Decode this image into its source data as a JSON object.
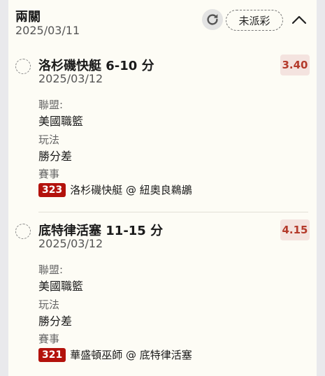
{
  "header": {
    "title": "兩關",
    "date": "2025/03/11",
    "status_label": "未派彩"
  },
  "picks": [
    {
      "title": "洛杉磯快艇 6-10 分",
      "date": "2025/03/12",
      "odds": "3.40",
      "league_label": "聯盟:",
      "league": "美國職籃",
      "market_label": "玩法",
      "market": "勝分差",
      "event_label": "賽事",
      "event_no": "323",
      "event": "洛杉磯快艇 @ 紐奧良鵜鶘"
    },
    {
      "title": "底特律活塞 11-15 分",
      "date": "2025/03/12",
      "odds": "4.15",
      "league_label": "聯盟:",
      "league": "美國職籃",
      "market_label": "玩法",
      "market": "勝分差",
      "event_label": "賽事",
      "event_no": "321",
      "event": "華盛頓巫師 @ 底特律活塞"
    }
  ],
  "colors": {
    "odds_text": "#b43a2b",
    "odds_bg": "#f4e3df",
    "event_badge": "#b3120c",
    "card_bg": "#fdfcf5"
  },
  "icons": {
    "refresh": "refresh-icon",
    "collapse": "chevron-up-icon",
    "select": "radio-icon"
  }
}
